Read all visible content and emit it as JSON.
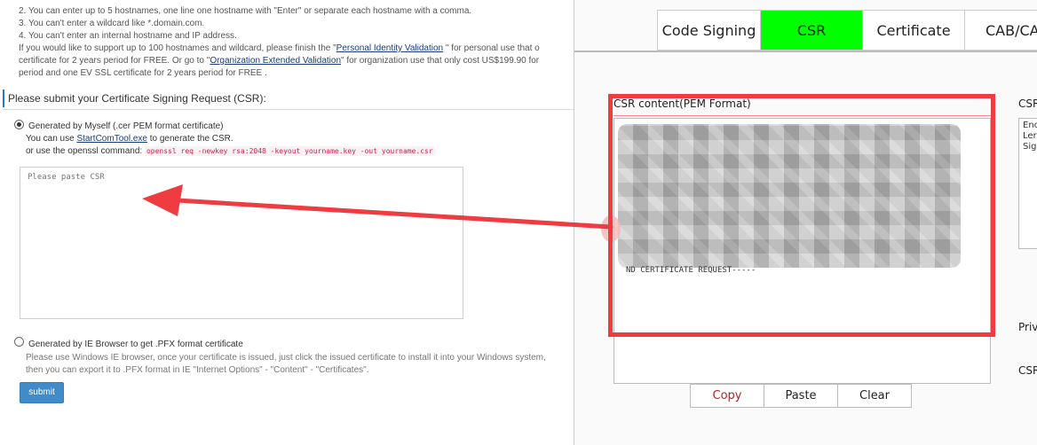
{
  "left": {
    "notes": [
      "2. You can enter up to 5 hostnames, one line one hostname with \"Enter\" or separate each hostname with a comma.",
      "3. You can't enter a wildcard like *.domain.com.",
      "4. You can't enter an internal hostname and IP address."
    ],
    "support_line1_a": "If you would like to support up to 100 hostnames and wildcard, please finish the \"",
    "support_link1": "Personal Identity Validation",
    "support_line1_b": " \" for personal use that o",
    "support_line2_a": "certificate for 2 years period for FREE.  Or go to \"",
    "support_link2": "Organization Extended Validation",
    "support_line2_b": "\" for organization use that only cost US$199.90 for",
    "support_line3": "period and one EV SSL certificate for 2 years period for FREE .",
    "section_title": "Please submit your Certificate Signing Request (CSR):",
    "option1": {
      "label": "Generated by Myself  (.cer PEM format certificate)",
      "line1_a": "You can use ",
      "line1_link": "StartComTool.exe",
      "line1_b": " to generate the CSR.",
      "line2": "or use the openssl command:",
      "command": "openssl req -newkey rsa:2048 -keyout yourname.key -out yourname.csr"
    },
    "textarea_placeholder": "Please paste CSR",
    "option2": {
      "label": "Generated by IE Browser to get .PFX format certificate",
      "line1": "Please use Windows IE browser, once your certificate is issued, just click the issued certificate to install it into your Windows system,",
      "line2": "then you can export it to .PFX format in IE \"Internet Options\" - \"Content\" - \"Certificates\"."
    },
    "submit_label": "submit"
  },
  "right": {
    "tabs": [
      {
        "label": "Code Signing"
      },
      {
        "label": "CSR"
      },
      {
        "label": "Certificate"
      },
      {
        "label": "CAB/CAT"
      }
    ],
    "active_tab": "CSR",
    "pem_label": "CSR content(PEM Format)",
    "pem_tail": "ND CERTIFICATE REQUEST-----",
    "buttons": {
      "copy": "Copy",
      "paste": "Paste",
      "clear": "Clear"
    },
    "side": {
      "csr_label": "CSR",
      "box_lines": [
        "Enc",
        "Ler",
        "Sig"
      ],
      "priv_label": "Priv",
      "csr2_label": "CSR"
    }
  },
  "colors": {
    "active_tab": "#00ff00",
    "highlight": "#ee3c40",
    "submit": "#428bca",
    "link": "#1a3c7a"
  }
}
